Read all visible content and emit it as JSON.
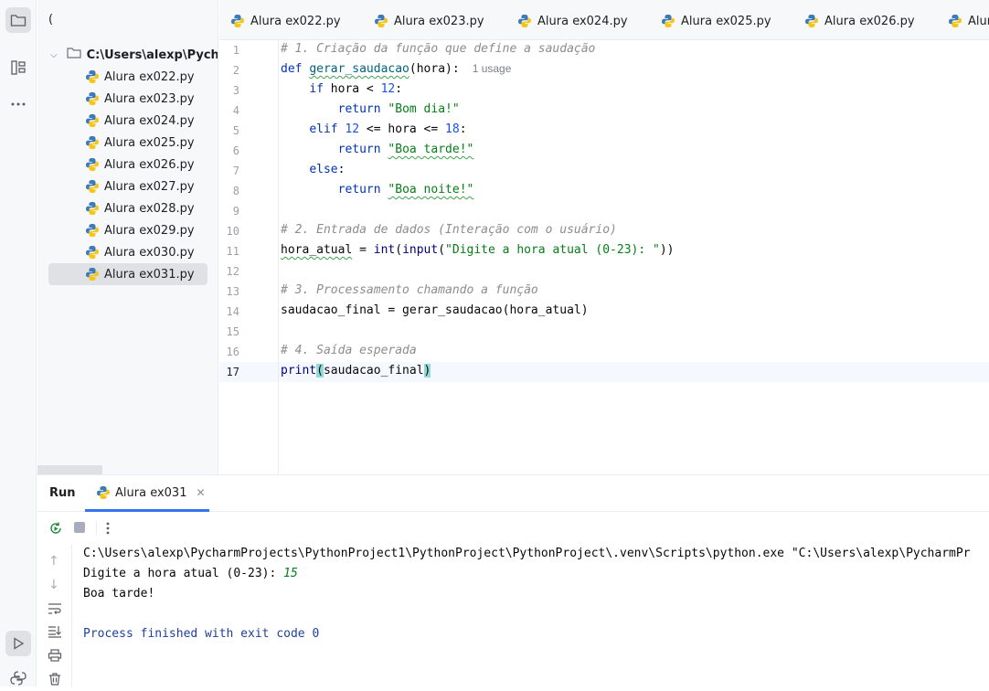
{
  "project": {
    "root_label": "C:\\Users\\alexp\\Pycharm",
    "files": [
      "Alura ex022.py",
      "Alura ex023.py",
      "Alura ex024.py",
      "Alura ex025.py",
      "Alura ex026.py",
      "Alura ex027.py",
      "Alura ex028.py",
      "Alura ex029.py",
      "Alura ex030.py",
      "Alura ex031.py"
    ],
    "selected_file": "Alura ex031.py"
  },
  "tabs": [
    "Alura ex022.py",
    "Alura ex023.py",
    "Alura ex024.py",
    "Alura ex025.py",
    "Alura ex026.py",
    "Alur"
  ],
  "editor": {
    "line_numbers": [
      "1",
      "2",
      "3",
      "4",
      "5",
      "6",
      "7",
      "8",
      "9",
      "10",
      "11",
      "12",
      "13",
      "14",
      "15",
      "16",
      "17"
    ],
    "usage_hint": "1 usage",
    "comment1": "# 1. Criação da função que define a saudação",
    "line2_def": "def ",
    "line2_name": "gerar_saudacao",
    "line2_rest": "(hora):",
    "line3_if": "if ",
    "line3_cond": "hora < ",
    "line3_num": "12",
    "line3_colon": ":",
    "return_kw": "return ",
    "line4_str": "\"Bom dia!\"",
    "line5_elif": "elif ",
    "line5_num1": "12",
    "line5_mid": " <= hora <= ",
    "line5_num2": "18",
    "line5_colon": ":",
    "line6_str": "\"Boa tarde!\"",
    "line7_else": "else",
    "line7_colon": ":",
    "line8_str": "\"Boa noite!\"",
    "comment2": "# 2. Entrada de dados (Interação com o usuário)",
    "line11_var": "hora_atual",
    "line11_eq": " = ",
    "line11_int": "int",
    "line11_p1": "(",
    "line11_input": "input",
    "line11_p2": "(",
    "line11_str": "\"Digite a hora atual (0-23): \"",
    "line11_close": "))",
    "comment3": "# 3. Processamento chamando a função",
    "line14": "saudacao_final = gerar_saudacao(hora_atual)",
    "comment4": "# 4. Saída esperada",
    "line17_print": "print",
    "line17_open": "(",
    "line17_arg": "saudacao_final",
    "line17_close": ")"
  },
  "run": {
    "title": "Run",
    "tab_label": "Alura ex031",
    "cmd_line": "C:\\Users\\alexp\\PycharmProjects\\PythonProject1\\PythonProject\\PythonProject\\.venv\\Scripts\\python.exe \"C:\\Users\\alexp\\PycharmPr",
    "prompt": "Digite a hora atual (0-23): ",
    "input_value": "15",
    "result": "Boa tarde!",
    "exit_msg": "Process finished with exit code 0"
  },
  "colors": {
    "keyword": "#0033b3",
    "string": "#067d17",
    "number": "#1750eb",
    "comment": "#8c8c8c",
    "selection": "#dfe1e5"
  },
  "icons": [
    "folder-icon",
    "structure-icon",
    "more-icon",
    "run-icon",
    "python-console-icon",
    "rerun-icon",
    "stop-icon",
    "scroll-up-icon",
    "scroll-down-icon",
    "soft-wrap-icon",
    "scroll-to-end-icon",
    "print-icon",
    "trash-icon",
    "close-icon",
    "python-file-icon"
  ]
}
